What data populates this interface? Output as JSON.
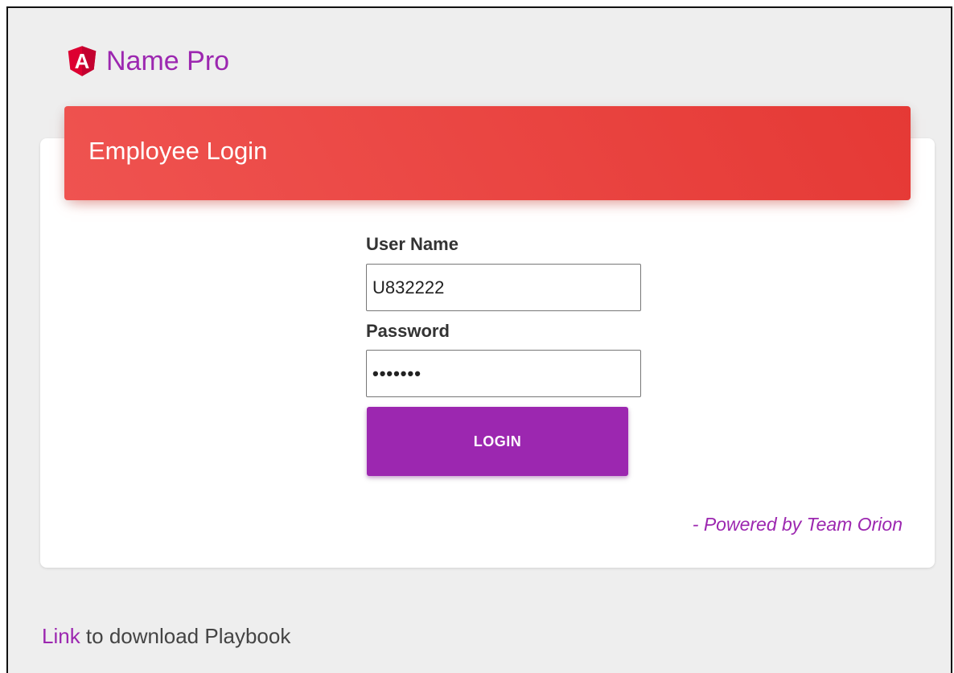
{
  "brand": {
    "logo_icon": "angular-logo-icon",
    "logo_letter": "A",
    "name": "Name Pro"
  },
  "login_card": {
    "title": "Employee Login",
    "username_label": "User Name",
    "username_value": "U832222",
    "password_label": "Password",
    "password_value": "•••••••",
    "login_button_label": "LOGIN",
    "powered_by": "- Powered by Team Orion"
  },
  "footer": {
    "link_text": "Link",
    "link_suffix": " to download Playbook"
  },
  "colors": {
    "accent_purple": "#9c27b0",
    "header_red": "#e53935",
    "logo_red": "#dd0031",
    "background": "#eeeeee"
  }
}
